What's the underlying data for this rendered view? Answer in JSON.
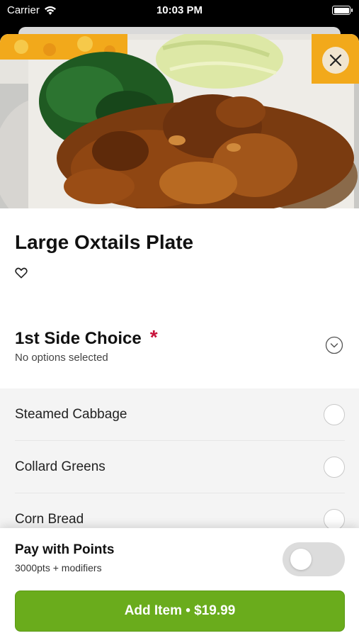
{
  "status_bar": {
    "carrier": "Carrier",
    "time": "10:03 PM"
  },
  "item": {
    "title": "Large Oxtails Plate"
  },
  "side_choice": {
    "title": "1st Side Choice",
    "required_marker": "*",
    "subtitle": "No options selected",
    "options": [
      {
        "label": "Steamed Cabbage"
      },
      {
        "label": "Collard Greens"
      },
      {
        "label": "Corn Bread"
      }
    ]
  },
  "points": {
    "title": "Pay with Points",
    "subtitle": "3000pts + modifiers",
    "toggle_on": false
  },
  "add_button": {
    "label": "Add Item • $19.99"
  },
  "colors": {
    "accent_green": "#6aac1c",
    "required_red": "#c8143c",
    "close_bg": "#f1e5cf"
  },
  "icons": [
    "wifi-icon",
    "battery-icon",
    "close-icon",
    "heart-icon",
    "chevron-down-icon"
  ]
}
